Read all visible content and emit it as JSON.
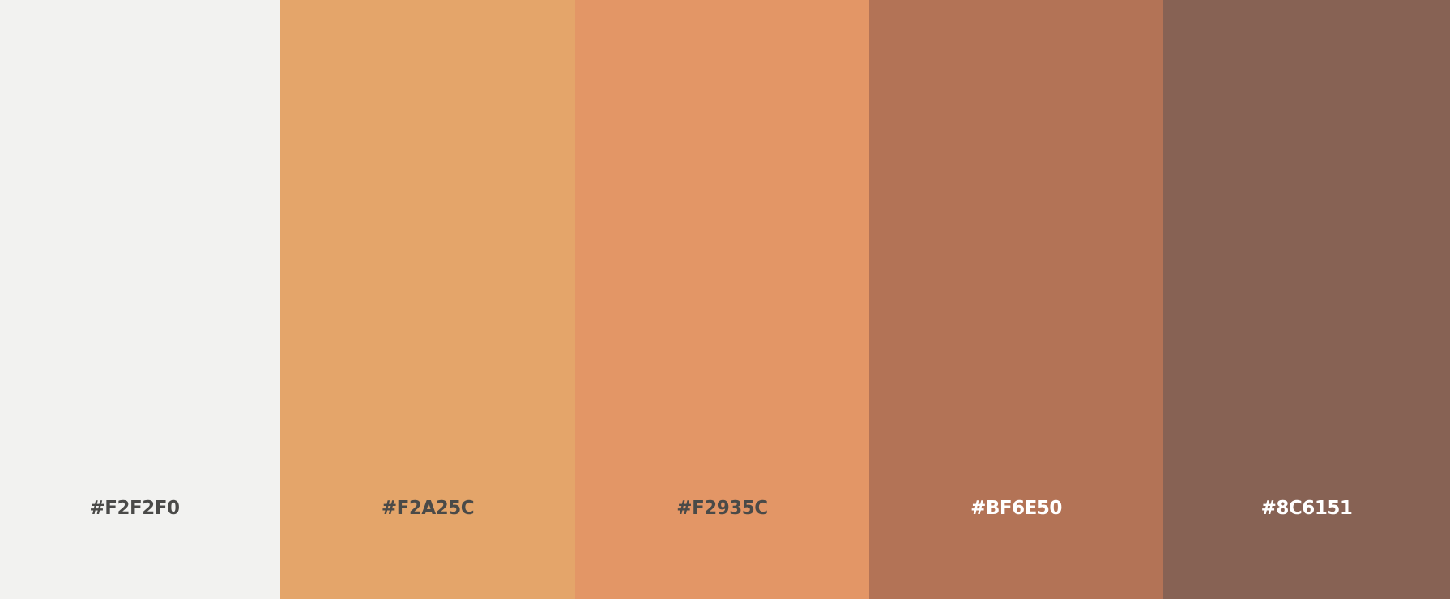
{
  "palette": {
    "swatches": [
      {
        "hex_label": "#F2F2F0",
        "color": "#f2f2f0",
        "text_color": "#4a4a48"
      },
      {
        "hex_label": "#F2A25C",
        "color": "#e4a56a",
        "text_color": "#4a4a48"
      },
      {
        "hex_label": "#F2935C",
        "color": "#e39666",
        "text_color": "#4a4a48"
      },
      {
        "hex_label": "#BF6E50",
        "color": "#b37356",
        "text_color": "#ffffff"
      },
      {
        "hex_label": "#8C6151",
        "color": "#876254",
        "text_color": "#ffffff"
      }
    ]
  }
}
